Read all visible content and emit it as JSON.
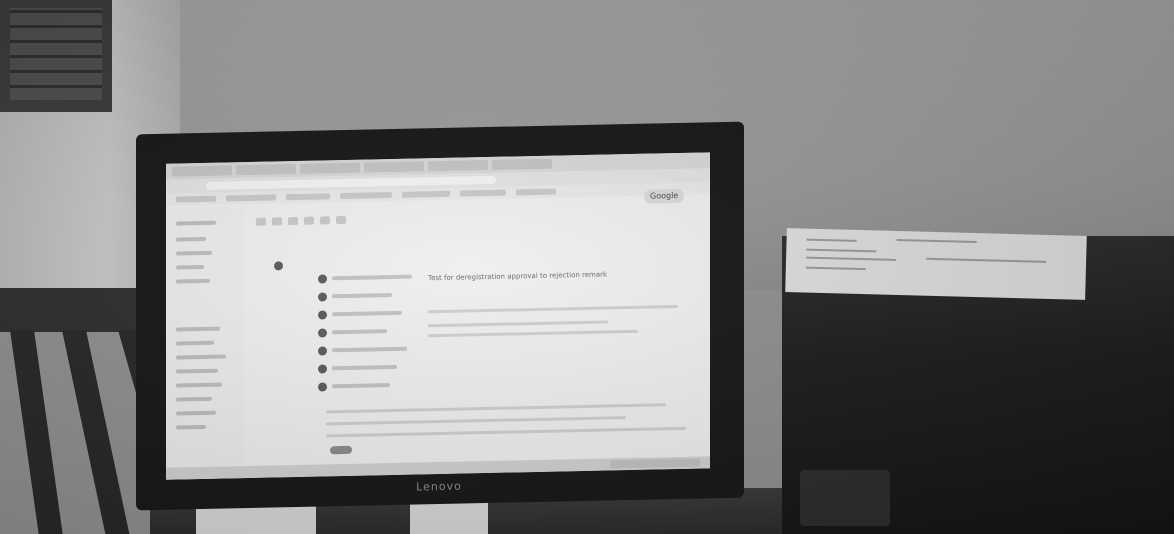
{
  "scene": {
    "monitor_brand": "Lenovo",
    "screen": {
      "search_button_label": "Google",
      "subject_text": "Test for deregistration approval to rejection remark"
    }
  },
  "palette": {
    "wall": "#a6a6a6",
    "monitor_bezel": "#161616",
    "screen": "#efefef",
    "cpu": "#1c1c1c",
    "railing": "#2d2d2d"
  }
}
